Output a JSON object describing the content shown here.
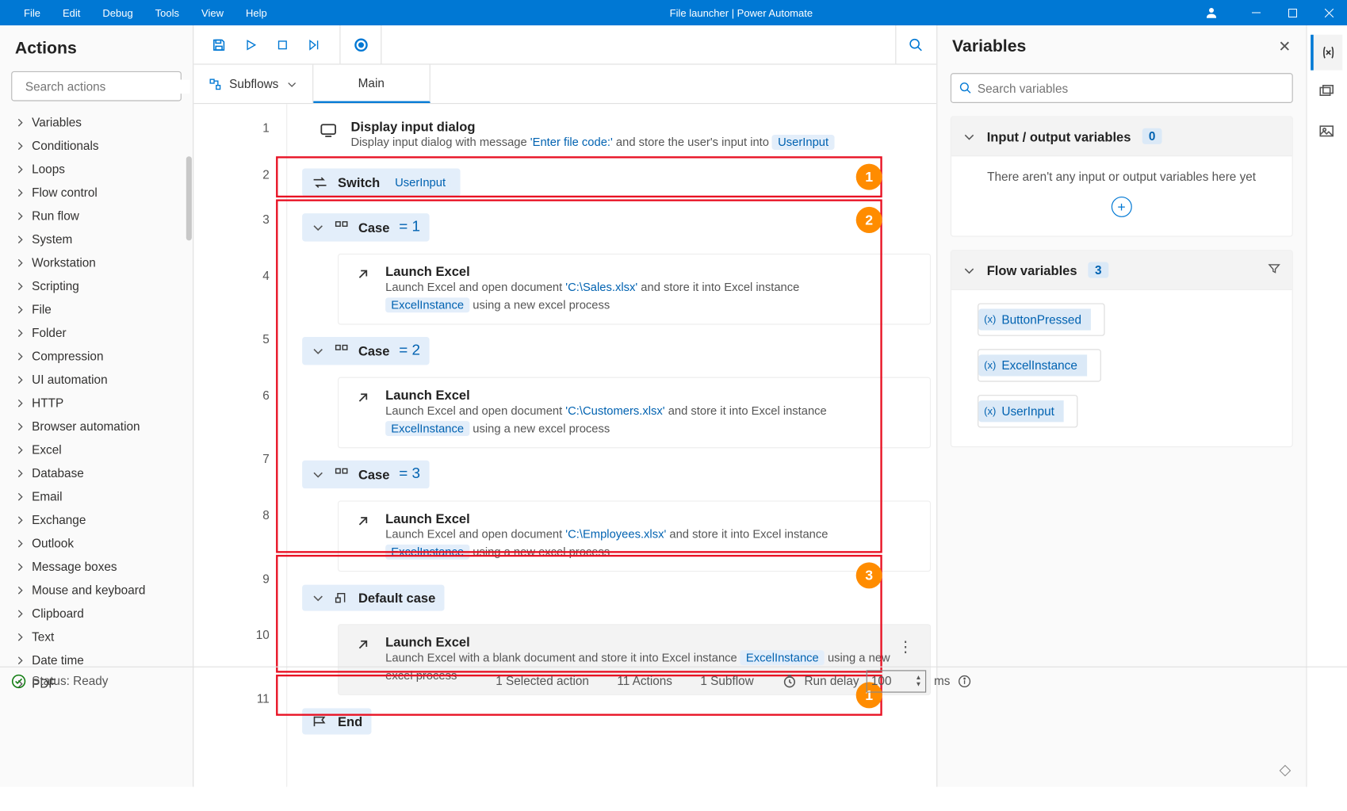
{
  "titlebar": {
    "menus": [
      "File",
      "Edit",
      "Debug",
      "Tools",
      "View",
      "Help"
    ],
    "title": "File launcher | Power Automate"
  },
  "actions": {
    "heading": "Actions",
    "search_placeholder": "Search actions",
    "items": [
      "Variables",
      "Conditionals",
      "Loops",
      "Flow control",
      "Run flow",
      "System",
      "Workstation",
      "Scripting",
      "File",
      "Folder",
      "Compression",
      "UI automation",
      "HTTP",
      "Browser automation",
      "Excel",
      "Database",
      "Email",
      "Exchange",
      "Outlook",
      "Message boxes",
      "Mouse and keyboard",
      "Clipboard",
      "Text",
      "Date time",
      "PDF"
    ]
  },
  "toolbar": {},
  "subflows": {
    "label": "Subflows",
    "main": "Main"
  },
  "flow": {
    "step1": {
      "title": "Display input dialog",
      "desc1": "Display input dialog with message ",
      "msg": "'Enter file code:'",
      "desc2": " and store the user's input into ",
      "var": "UserInput"
    },
    "switch_label": "Switch",
    "switch_var": "UserInput",
    "case_label": "Case",
    "case_vals": [
      "= 1",
      "= 2",
      "= 3"
    ],
    "launch_title": "Launch Excel",
    "launch_pre": "Launch Excel and open document ",
    "launch_post": " and store it into Excel instance ",
    "paths": [
      "'C:\\Sales.xlsx'",
      "'C:\\Customers.xlsx'",
      "'C:\\Employees.xlsx'"
    ],
    "inst": "ExcelInstance",
    "using": "  using a new excel process",
    "default_label": "Default case",
    "default_desc1": "Launch Excel with a blank document and store it into Excel instance ",
    "default_desc2": "  using a new excel process",
    "end_label": "End"
  },
  "vars": {
    "heading": "Variables",
    "search_placeholder": "Search variables",
    "io_label": "Input / output variables",
    "io_count": "0",
    "io_empty": "There aren't any input or output variables here yet",
    "flow_label": "Flow variables",
    "flow_count": "3",
    "list": [
      "ButtonPressed",
      "ExcelInstance",
      "UserInput"
    ]
  },
  "status": {
    "ready": "Status: Ready",
    "selected": "1 Selected action",
    "actions": "11 Actions",
    "subflow": "1 Subflow",
    "delay_label": "Run delay",
    "delay_value": "100",
    "ms": "ms"
  },
  "callouts": {
    "c1": "1",
    "c2": "2",
    "c3": "3",
    "c4": "1"
  }
}
